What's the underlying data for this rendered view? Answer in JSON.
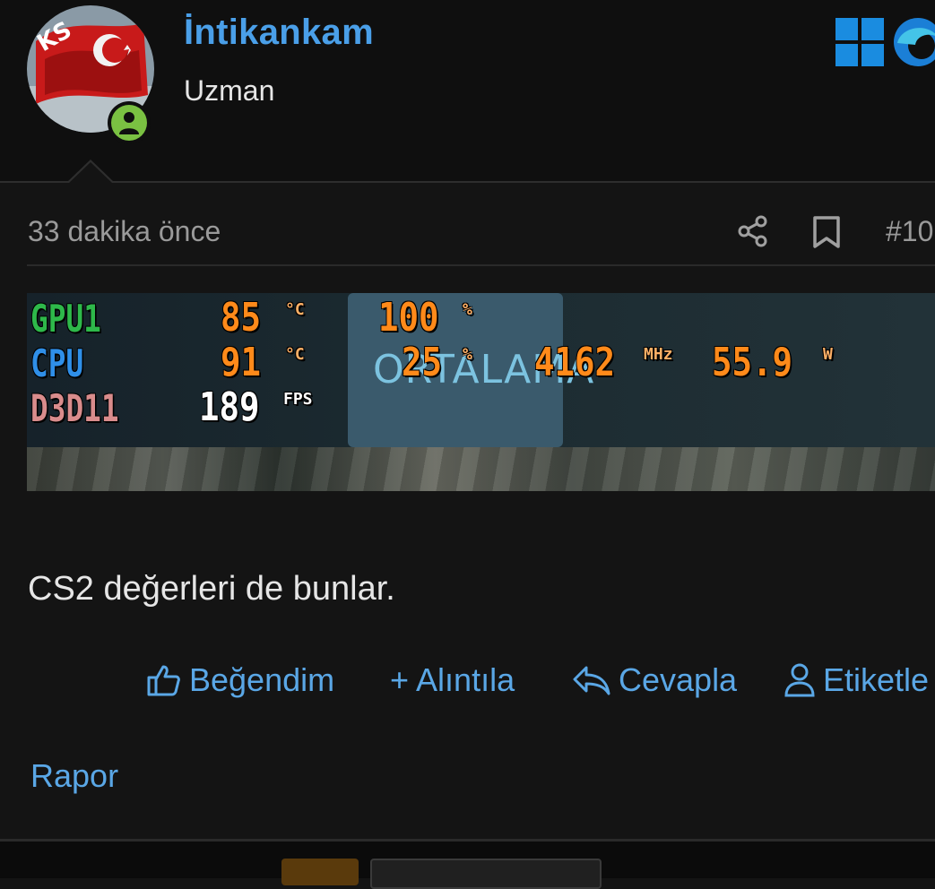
{
  "user": {
    "name": "İntikankam",
    "title": "Uzman",
    "avatar_badge": "KS"
  },
  "post": {
    "time": "33 dakika önce",
    "number": "#10",
    "body": "CS2 değerleri de bunlar."
  },
  "osd": {
    "gpu_label": "GPU1",
    "gpu_temp": "85",
    "gpu_temp_unit": "°C",
    "gpu_load": "100",
    "gpu_load_unit": "%",
    "cpu_label": "CPU",
    "cpu_temp": "91",
    "cpu_temp_unit": "°C",
    "cpu_load": "25",
    "cpu_load_unit": "%",
    "cpu_clock": "4162",
    "cpu_clock_unit": "MHz",
    "cpu_power": "55.9",
    "cpu_power_unit": "W",
    "api_label": "D3D11",
    "fps": "189",
    "fps_unit": "FPS",
    "ghost_text": "ORTALAMA",
    "colors": {
      "gpu": "#2eb84a",
      "cpu": "#2f8fe8",
      "api": "#d98c8c",
      "value": "#ff8a1a",
      "fps": "#ffffff"
    }
  },
  "actions": {
    "like": "Beğendim",
    "quote": "+ Alıntıla",
    "reply": "Cevapla",
    "tag": "Etiketle",
    "report": "Rapor"
  },
  "colors": {
    "accent": "#4a9fe8",
    "online": "#7ac142",
    "background": "#141414"
  }
}
